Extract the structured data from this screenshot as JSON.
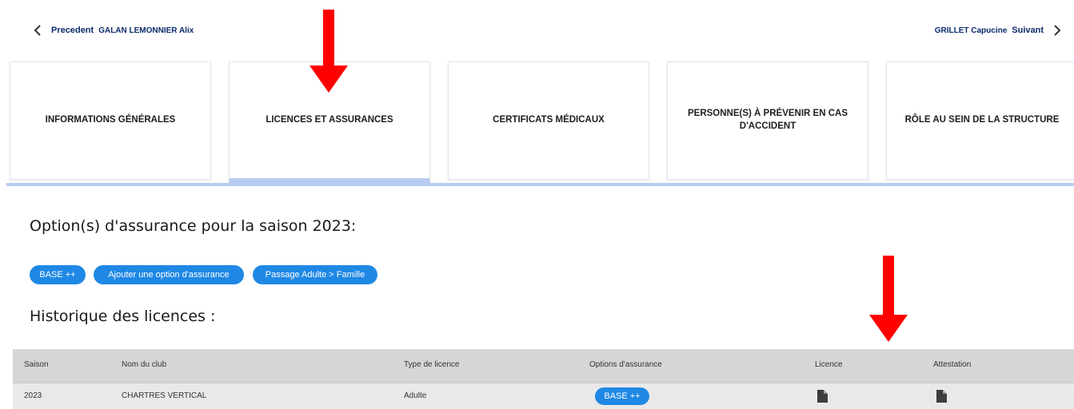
{
  "navigation": {
    "previous_label": "Precedent",
    "previous_name": "GALAN LEMONNIER Alix",
    "next_name": "GRILLET Capucine",
    "next_label": "Suivant"
  },
  "tabs": [
    {
      "label": "INFORMATIONS GÉNÉRALES"
    },
    {
      "label": "LICENCES ET ASSURANCES"
    },
    {
      "label": "CERTIFICATS MÉDICAUX"
    },
    {
      "label": "PERSONNE(S) À PRÉVENIR EN CAS D'ACCIDENT"
    },
    {
      "label": "RÔLE AU SEIN DE LA STRUCTURE"
    }
  ],
  "insurance": {
    "title": "Option(s) d'assurance pour la saison 2023:",
    "buttons": [
      {
        "label": "BASE ++"
      },
      {
        "label": "Ajouter une option d'assurance"
      },
      {
        "label": "Passage Adulte > Famille"
      }
    ]
  },
  "history": {
    "title": "Historique des licences :",
    "columns": [
      "Saison",
      "Nom du club",
      "Type de licence",
      "Options d'assurance",
      "Licence",
      "Attestation"
    ],
    "rows": [
      {
        "season": "2023",
        "club": "CHARTRES VERTICAL",
        "type": "Adulte",
        "option": "BASE ++"
      }
    ]
  },
  "icons": {
    "prev": "chevron-left-icon",
    "next": "chevron-right-icon",
    "document": "document-icon",
    "arrow": "red-down-arrow"
  },
  "colors": {
    "accent": "#1f88e5",
    "nav_text": "#0b2a6b",
    "annotation": "#ff0000"
  }
}
